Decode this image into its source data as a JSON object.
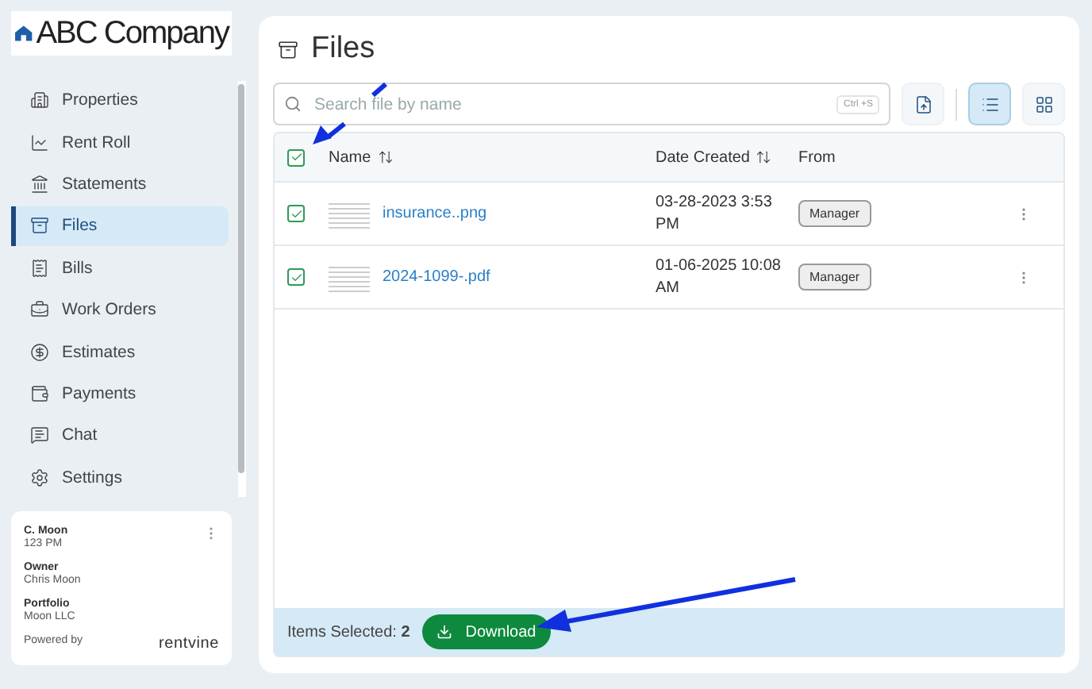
{
  "logo": {
    "text": "ABC Company"
  },
  "nav": [
    {
      "label": "Properties",
      "selected": false
    },
    {
      "label": "Rent Roll",
      "selected": false
    },
    {
      "label": "Statements",
      "selected": false
    },
    {
      "label": "Files",
      "selected": true
    },
    {
      "label": "Bills",
      "selected": false
    },
    {
      "label": "Work Orders",
      "selected": false
    },
    {
      "label": "Estimates",
      "selected": false
    },
    {
      "label": "Payments",
      "selected": false
    },
    {
      "label": "Chat",
      "selected": false
    },
    {
      "label": "Settings",
      "selected": false
    }
  ],
  "user_card": {
    "name": "C. Moon",
    "unit": "123 PM",
    "fields": [
      {
        "label": "Owner",
        "value": "Chris Moon"
      },
      {
        "label": "Portfolio",
        "value": "Moon LLC"
      }
    ],
    "powered_by": "Powered by",
    "brand": "rentvine"
  },
  "page": {
    "title": "Files",
    "search": {
      "placeholder": "Search file by name",
      "shortcut": "Ctrl +S"
    },
    "views": [
      {
        "kind": "list",
        "selected": true
      },
      {
        "kind": "grid",
        "selected": false
      }
    ]
  },
  "table": {
    "all_checked": true,
    "columns": [
      {
        "label": "Name",
        "sortable": true
      },
      {
        "label": "Date Created",
        "sortable": true
      },
      {
        "label": "From",
        "sortable": false
      }
    ],
    "rows": [
      {
        "checked": true,
        "name": "insurance..png",
        "date": "03-28-2023 3:53 PM",
        "from": "Manager"
      },
      {
        "checked": true,
        "name": "2024-1099-.pdf",
        "date": "01-06-2025 10:08 AM",
        "from": "Manager"
      }
    ]
  },
  "footer": {
    "label": "Items Selected:",
    "count": "2",
    "button": "Download"
  }
}
